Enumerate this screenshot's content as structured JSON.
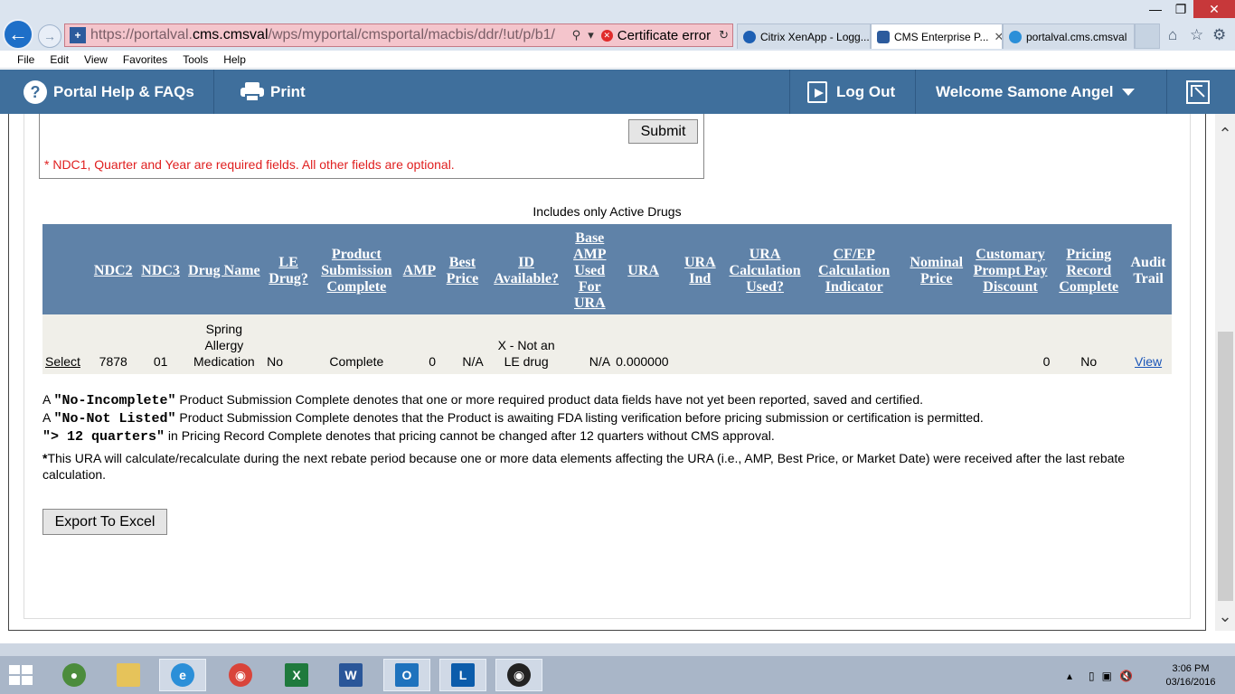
{
  "browser": {
    "url_prefix": "https://portalval.",
    "url_host": "cms.cmsval",
    "url_path": "/wps/myportal/cmsportal/macbis/ddr/!ut/p/b1/",
    "cert_error": "Certificate error",
    "tabs": [
      {
        "label": "Citrix XenApp - Logg..."
      },
      {
        "label": "CMS Enterprise P..."
      },
      {
        "label": "portalval.cms.cmsval"
      }
    ],
    "menu": [
      "File",
      "Edit",
      "View",
      "Favorites",
      "Tools",
      "Help"
    ]
  },
  "header": {
    "help": "Portal Help & FAQs",
    "print": "Print",
    "logout": "Log Out",
    "welcome": "Welcome Samone Angel"
  },
  "search": {
    "submit": "Submit",
    "required_note": "* NDC1, Quarter and Year are required fields. All other fields are optional."
  },
  "grid": {
    "caption": "Includes only Active Drugs",
    "columns": {
      "ndc2": "NDC2",
      "ndc3": "NDC3",
      "drug_name": "Drug Name",
      "le_drug": "LE Drug?",
      "product_submission": "Product Submission Complete",
      "amp": "AMP",
      "best_price": "Best Price",
      "id_available": "ID Available?",
      "base_amp": "Base AMP Used For URA",
      "ura": "URA",
      "ura_ind": "URA Ind",
      "ura_calc": "URA Calculation Used?",
      "cfep": "CF/EP Calculation Indicator",
      "nominal": "Nominal Price",
      "customer_prompt": "Customary Prompt Pay Discount",
      "pricing_record": "Pricing Record Complete",
      "audit": "Audit Trail"
    },
    "row": {
      "select": "Select",
      "ndc2": "7878",
      "ndc3": "01",
      "drug_name": "Spring Allergy Medication",
      "le_drug": "No",
      "product_submission": "Complete",
      "amp": "0",
      "best_price": "N/A",
      "id_available": "X - Not an LE drug",
      "base_amp": "N/A",
      "ura": "0.000000",
      "ura_ind": "",
      "ura_calc": "",
      "cfep": "",
      "nominal": "",
      "customer_prompt": "0",
      "pricing_record": "No",
      "audit": "View"
    }
  },
  "legend": {
    "a1": "A ",
    "term1": "\"No-Incomplete\"",
    "text1": " Product Submission Complete denotes that one or more required product data fields have not yet been reported, saved and certified.",
    "a2": "A ",
    "term2": "\"No-Not Listed\"",
    "text2": " Product Submission Complete denotes that the Product is awaiting FDA listing verification before pricing submission or certification is permitted.",
    "term3": "\"> 12 quarters\"",
    "text3": " in Pricing Record Complete denotes that pricing cannot be changed after 12 quarters without CMS approval.",
    "star": "*",
    "ura_note": "This URA will calculate/recalculate during the next rebate period because one or more data elements affecting the URA (i.e., AMP, Best Price, or Market Date) were received after the last rebate calculation."
  },
  "export": "Export To Excel",
  "taskbar": {
    "time": "3:06 PM",
    "date": "03/16/2016"
  },
  "colors": {
    "header_bg": "#3f6f9c",
    "grid_header_bg": "#5f82a8",
    "row_bg": "#f0efe9",
    "error_text": "#e02020",
    "link": "#1a55b8"
  }
}
